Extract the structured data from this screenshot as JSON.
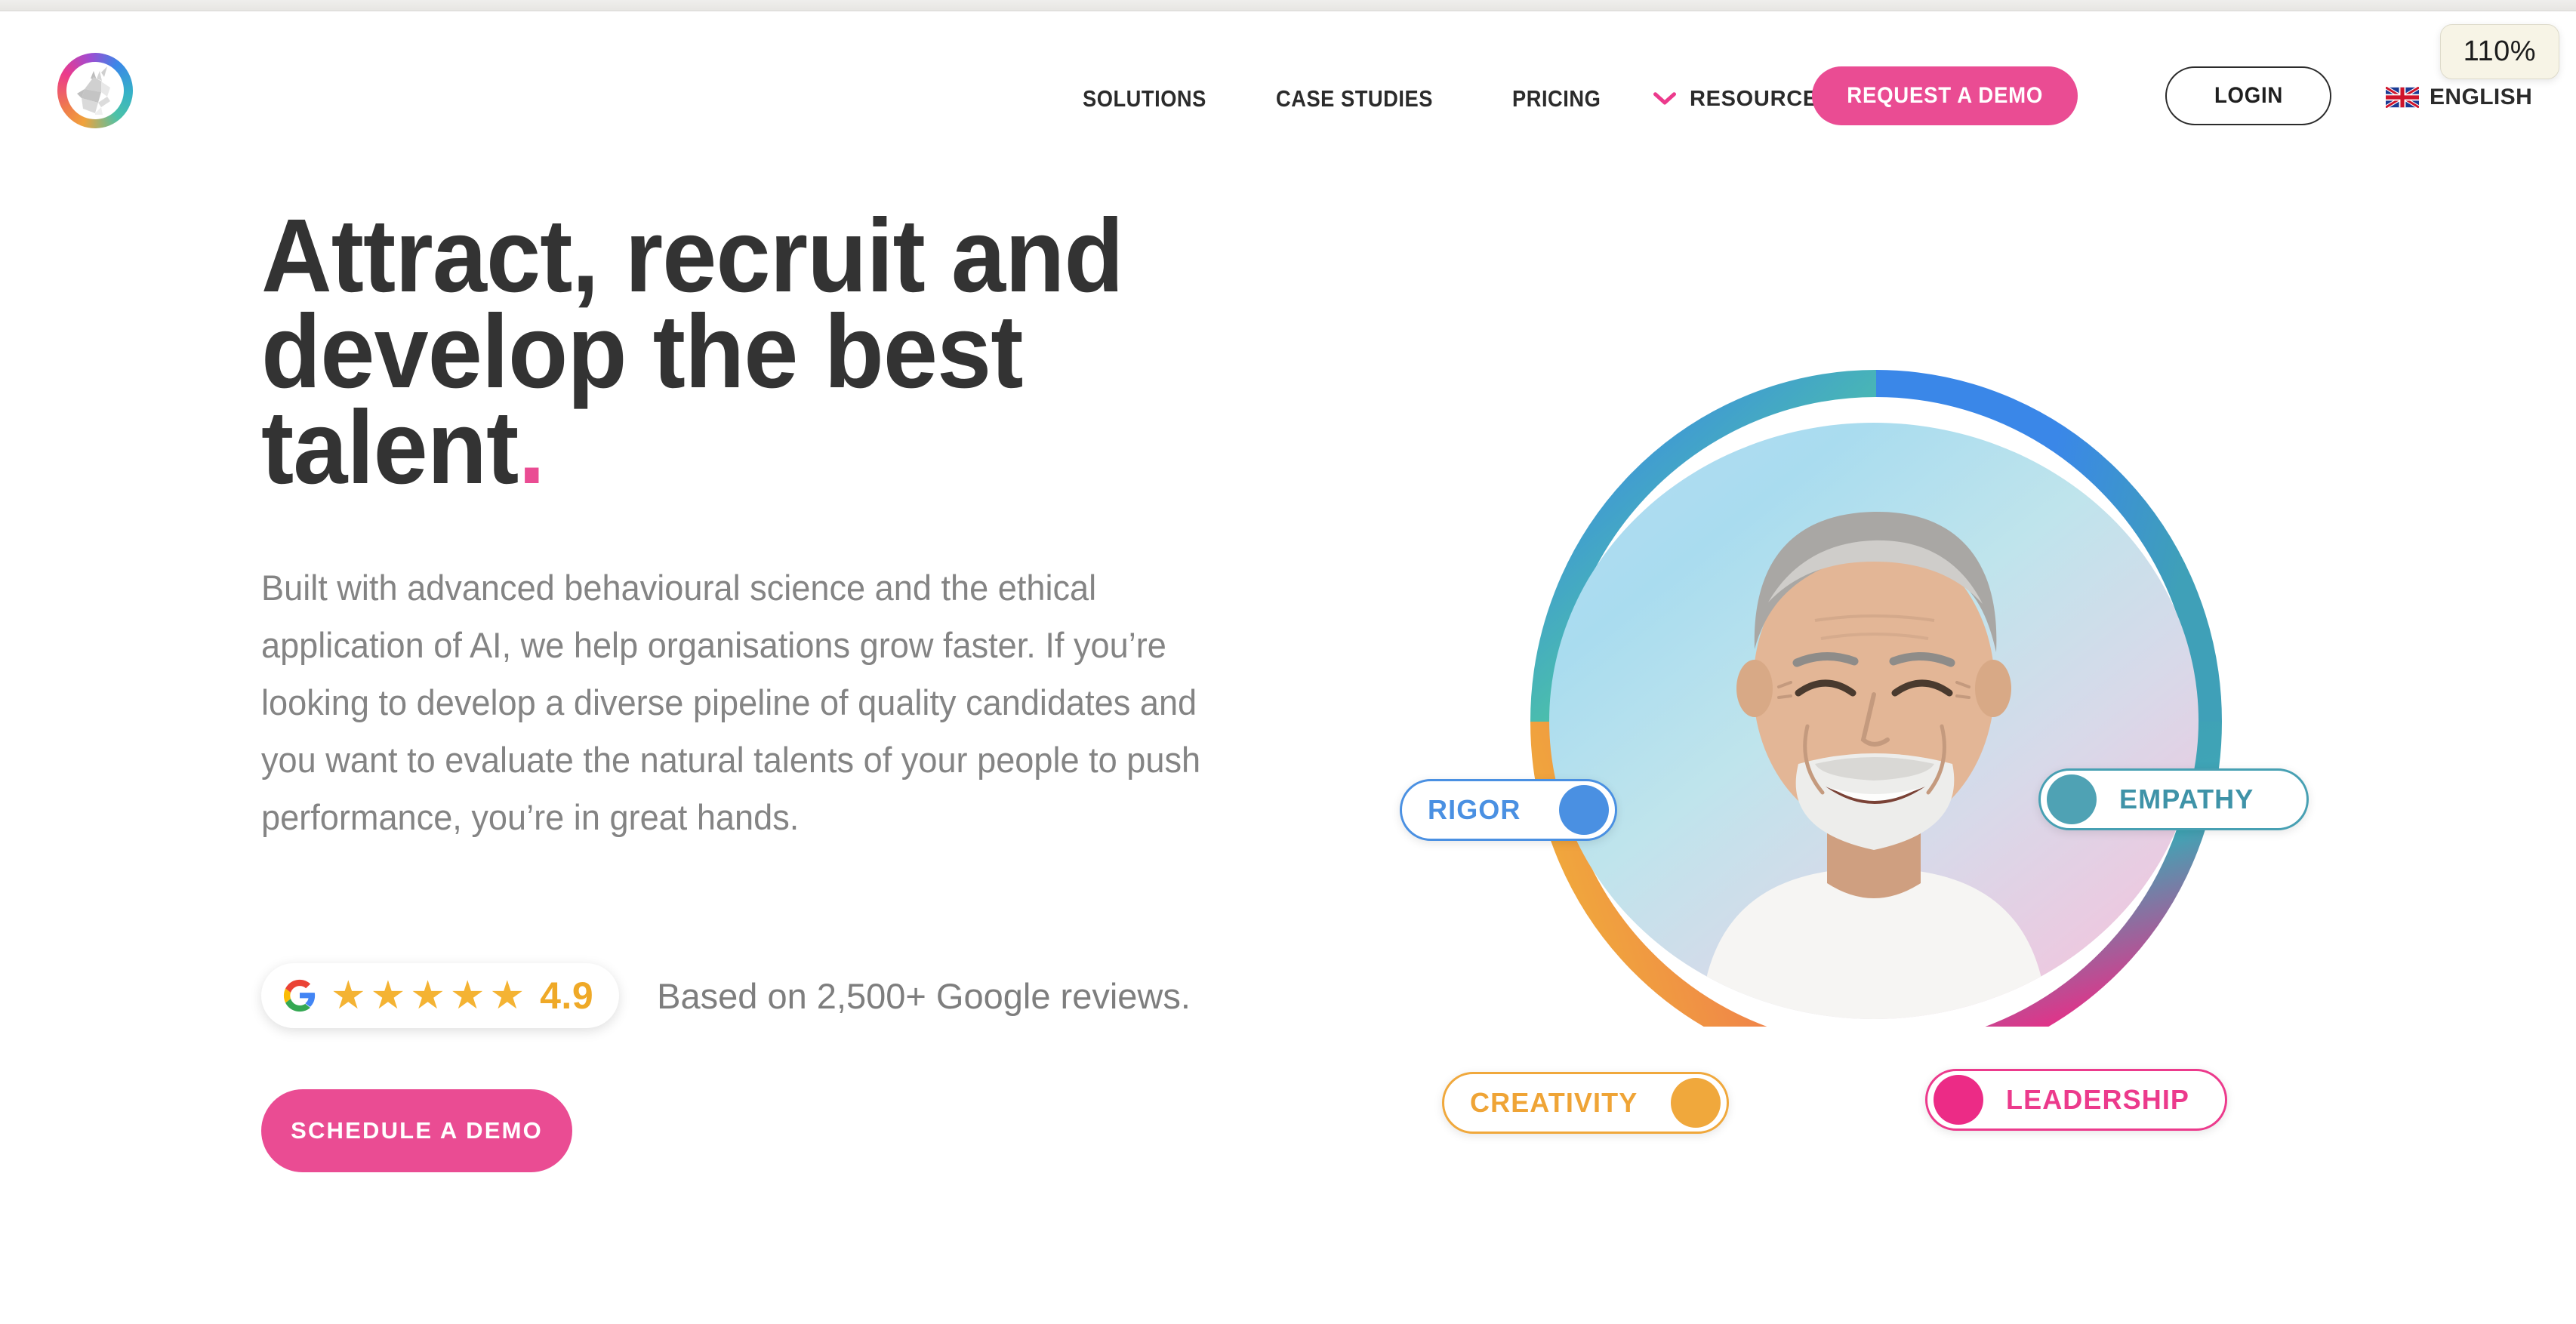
{
  "browser": {
    "zoom_level": "110%"
  },
  "header": {
    "logo_name": "unicorn-logo",
    "nav": [
      {
        "label": "SOLUTIONS",
        "icon": null
      },
      {
        "label": "CASE STUDIES",
        "icon": null
      },
      {
        "label": "PRICING",
        "icon": null
      },
      {
        "label": "RESOURCES",
        "icon": "chevron-down-icon"
      }
    ],
    "request_demo_label": "REQUEST A DEMO",
    "login_label": "LOGIN",
    "language": {
      "label": "ENGLISH",
      "flag": "uk-flag-icon"
    }
  },
  "hero": {
    "headline_line1": "Attract, recruit and",
    "headline_line2": "develop the best",
    "headline_line3": "talent",
    "headline_period": ".",
    "paragraph": "Built with advanced behavioural science and the ethical application of AI, we help organisations grow faster. If you’re looking to develop a diverse pipeline of quality candidates and you want to evaluate the natural talents of your people to push performance, you’re in great hands.",
    "review": {
      "logo": "google-g-icon",
      "stars": "★★★★★",
      "rating": "4.9",
      "caption": "Based on 2,500+ Google reviews."
    },
    "cta_label": "SCHEDULE A DEMO"
  },
  "graphic": {
    "portrait_alt": "smiling-senior-man-portrait",
    "pills": [
      {
        "label": "RIGOR",
        "color": "#4a90e2"
      },
      {
        "label": "EMPATHY",
        "color": "#47a0b3"
      },
      {
        "label": "CREATIVITY",
        "color": "#f0a83c"
      },
      {
        "label": "LEADERSHIP",
        "color": "#ec3a8c"
      }
    ]
  },
  "colors": {
    "brand_pink": "#ea4c93",
    "headline": "#333333",
    "body_text": "#848484",
    "star_gold": "#f4b333"
  }
}
